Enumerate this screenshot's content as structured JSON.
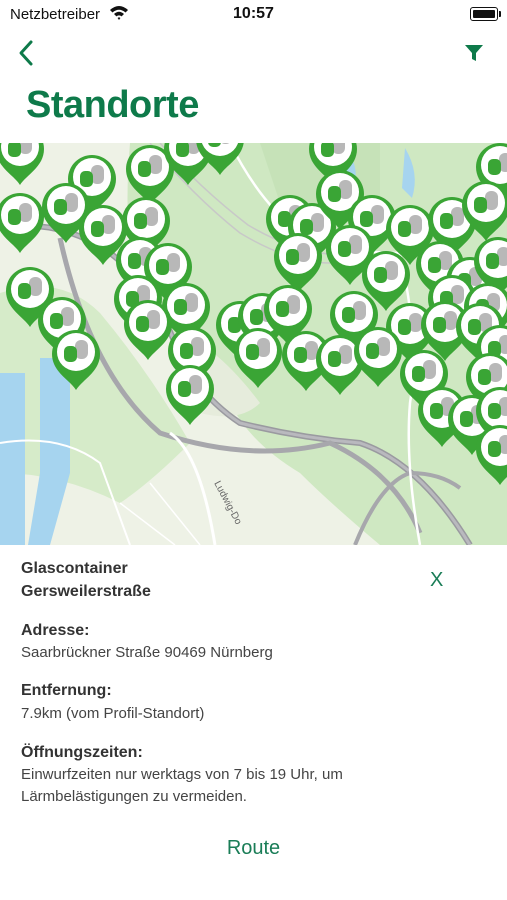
{
  "status_bar": {
    "carrier": "Netzbetreiber",
    "time": "10:57"
  },
  "nav": {
    "title": "Standorte"
  },
  "colors": {
    "accent": "#0e7a4a",
    "marker": "#3aa535",
    "map_green": "#cfe8c2",
    "water": "#a6d4ef"
  },
  "map": {
    "street_label": "Ludwig-Do"
  },
  "detail": {
    "title_line1": "Glascontainer",
    "title_line2": "Gersweilerstraße",
    "close_label": "X",
    "address_label": "Adresse:",
    "address_value": "Saarbrückner Straße  90469 Nürnberg",
    "distance_label": "Entfernung:",
    "distance_value": "7.9km (vom Profil-Standort)",
    "hours_label": "Öffnungszeiten:",
    "hours_value": "Einwurfzeiten nur werktags von 7 bis 19 Uhr, um Lärmbelästigungen zu vermeiden.",
    "route_label": "Route"
  }
}
